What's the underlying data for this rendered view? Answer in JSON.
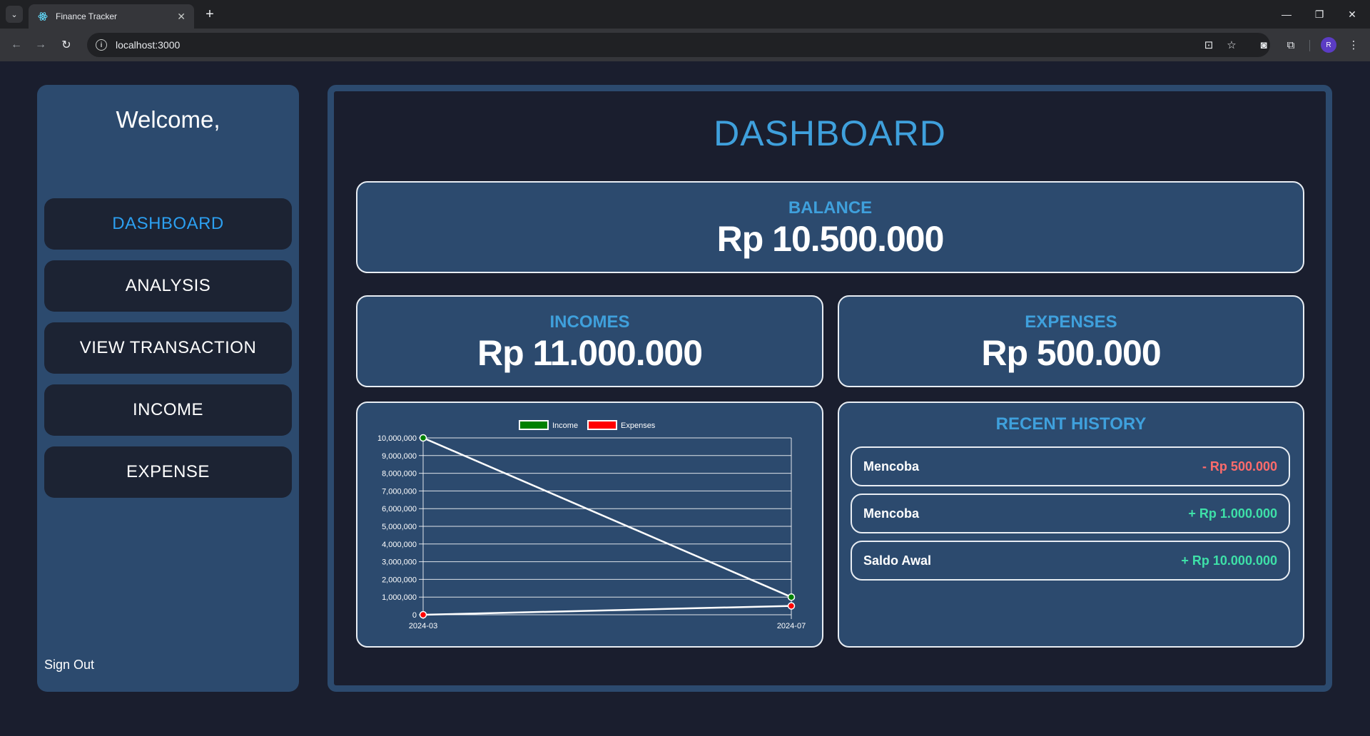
{
  "browser": {
    "tab_title": "Finance Tracker",
    "url": "localhost:3000",
    "profile_initial": "R"
  },
  "sidebar": {
    "welcome": "Welcome,",
    "items": [
      {
        "label": "DASHBOARD",
        "active": true
      },
      {
        "label": "ANALYSIS",
        "active": false
      },
      {
        "label": "VIEW TRANSACTION",
        "active": false
      },
      {
        "label": "INCOME",
        "active": false
      },
      {
        "label": "EXPENSE",
        "active": false
      }
    ],
    "sign_out": "Sign Out"
  },
  "main": {
    "title": "DASHBOARD",
    "balance": {
      "label": "BALANCE",
      "value": "Rp 10.500.000"
    },
    "incomes": {
      "label": "INCOMES",
      "value": "Rp 11.000.000"
    },
    "expenses": {
      "label": "EXPENSES",
      "value": "Rp 500.000"
    },
    "history": {
      "title": "RECENT HISTORY",
      "items": [
        {
          "name": "Mencoba",
          "amount": "- Rp 500.000",
          "type": "expense"
        },
        {
          "name": "Mencoba",
          "amount": "+ Rp 1.000.000",
          "type": "income"
        },
        {
          "name": "Saldo Awal",
          "amount": "+ Rp 10.000.000",
          "type": "income"
        }
      ]
    }
  },
  "chart_data": {
    "type": "line",
    "x": [
      "2024-03",
      "2024-07"
    ],
    "series": [
      {
        "name": "Income",
        "values": [
          10000000,
          1000000
        ],
        "marker_color": "#008000"
      },
      {
        "name": "Expenses",
        "values": [
          0,
          500000
        ],
        "marker_color": "#ff0000"
      }
    ],
    "yticks": [
      "0",
      "1,000,000",
      "2,000,000",
      "3,000,000",
      "4,000,000",
      "5,000,000",
      "6,000,000",
      "7,000,000",
      "8,000,000",
      "9,000,000",
      "10,000,000"
    ],
    "ylim": [
      0,
      10000000
    ],
    "grid": true,
    "legend": "top-center",
    "line_color": "#ffffff"
  },
  "colors": {
    "background": "#1a1e2e",
    "panel": "#2c4a6e",
    "accent": "#3fa0dc",
    "active_menu": "#2c9ff0",
    "negative": "#ff6b6b",
    "positive": "#3ee0a8"
  }
}
